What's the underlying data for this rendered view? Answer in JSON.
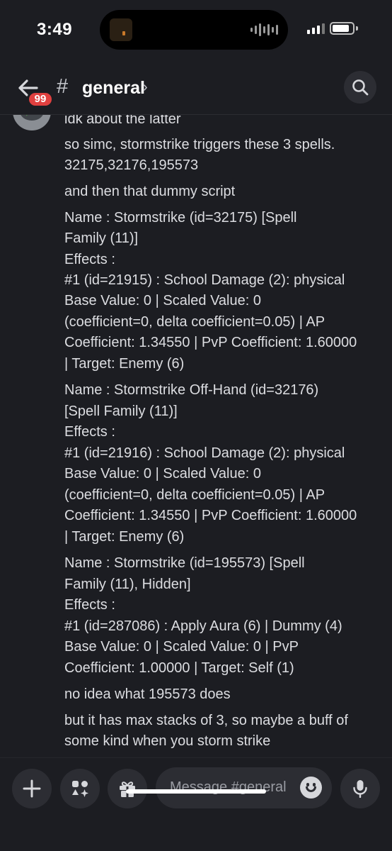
{
  "status_bar": {
    "time": "3:49"
  },
  "header": {
    "back_badge": "99",
    "hash": "#",
    "channel_name": "general",
    "chevron": "›"
  },
  "messages": {
    "lines": [
      "idk about the latter",
      "so simc, stormstrike triggers these 3 spells.",
      "32175,32176,195573",
      "and then that dummy script",
      "Name            : Stormstrike (id=32175) [Spell",
      "Family (11)]",
      "Effects          :",
      "#1 (id=21915)    : School Damage (2): physical",
      "                  Base Value: 0 | Scaled Value: 0",
      "(coefficient=0, delta coefficient=0.05) | AP",
      "Coefficient: 1.34550 | PvP Coefficient: 1.60000",
      "| Target: Enemy (6)",
      "Name            : Stormstrike Off-Hand (id=32176)",
      "[Spell Family (11)]",
      "Effects          :",
      "#1 (id=21916)    : School Damage (2): physical",
      "                  Base Value: 0 | Scaled Value: 0",
      "(coefficient=0, delta coefficient=0.05) | AP",
      "Coefficient: 1.34550 | PvP Coefficient: 1.60000",
      "| Target: Enemy (6)",
      "Name            : Stormstrike (id=195573) [Spell",
      "Family (11), Hidden]",
      "Effects          :",
      "#1 (id=287086)   : Apply Aura (6) | Dummy (4)",
      "                  Base Value: 0 | Scaled Value: 0 | PvP",
      "Coefficient: 1.00000 | Target: Self (1)",
      "no idea what 195573 does",
      "but it has max stacks of 3, so maybe a buff of",
      "some kind when you storm strike"
    ]
  },
  "composer": {
    "placeholder": "Message #general"
  }
}
